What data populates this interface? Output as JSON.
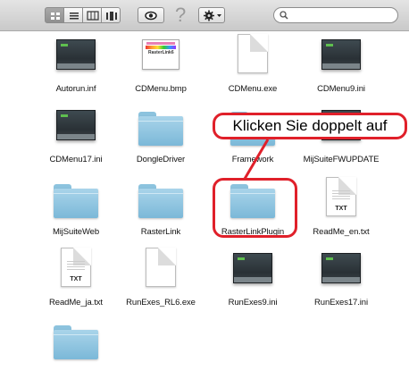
{
  "toolbar": {
    "view_buttons": [
      "icon-view",
      "list-view",
      "column-view",
      "coverflow-view"
    ],
    "quicklook": "eye-icon",
    "help_symbol": "?",
    "action": "gear-icon",
    "search_placeholder": ""
  },
  "files": [
    {
      "name": "Autorun.inf",
      "type": "ini"
    },
    {
      "name": "CDMenu.bmp",
      "type": "bmp"
    },
    {
      "name": "CDMenu.exe",
      "type": "doc"
    },
    {
      "name": "CDMenu9.ini",
      "type": "ini"
    },
    {
      "name": "CDMenu17.ini",
      "type": "ini"
    },
    {
      "name": "DongleDriver",
      "type": "folder"
    },
    {
      "name": "Framework",
      "type": "folder"
    },
    {
      "name": "MijSuiteFWUPDATE",
      "type": "ini"
    },
    {
      "name": "MijSuiteWeb",
      "type": "folder"
    },
    {
      "name": "RasterLink",
      "type": "folder"
    },
    {
      "name": "RasterLinkPlugin",
      "type": "folder"
    },
    {
      "name": "ReadMe_en.txt",
      "type": "txt"
    },
    {
      "name": "ReadMe_ja.txt",
      "type": "txt"
    },
    {
      "name": "RunExes_RL6.exe",
      "type": "doc"
    },
    {
      "name": "RunExes9.ini",
      "type": "ini"
    },
    {
      "name": "RunExes17.ini",
      "type": "ini"
    },
    {
      "name": "",
      "type": "folder"
    }
  ],
  "icon_labels": {
    "txt": "TXT",
    "bmp_logo": "RasterLink6"
  },
  "callout": {
    "text": "Klicken Sie doppelt auf"
  },
  "colors": {
    "highlight": "#e0202a",
    "folder": "#8cc3de"
  }
}
